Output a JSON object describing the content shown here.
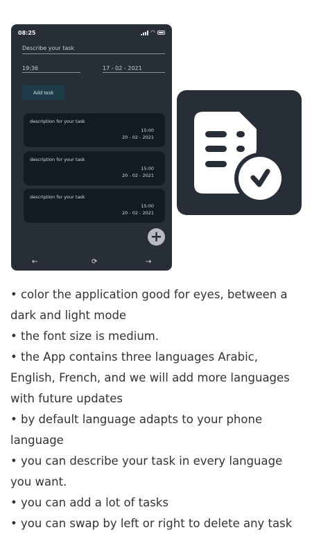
{
  "phone": {
    "status_time": "08:25",
    "task_placeholder": "Describe your task",
    "time_value": "19:36",
    "date_value": "17 - 02 - 2021",
    "add_task_label": "Add task",
    "tasks": [
      {
        "description": "description for your task",
        "time": "15:00",
        "date": "20 - 02 - 2021"
      },
      {
        "description": "description for your task",
        "time": "15:00",
        "date": "20 - 02 - 2021"
      },
      {
        "description": "description for your task",
        "time": "15:00",
        "date": "20 - 02 - 2021"
      }
    ],
    "nav": {
      "back": "←",
      "home": "⟳",
      "forward": "→"
    },
    "fab_symbol": "+"
  },
  "app_icon": {
    "name": "task-checklist-icon",
    "bg": "#272e38",
    "fg": "#ffffff"
  },
  "features": [
    "• color the application good for eyes, between a dark and light mode",
    "• the font size is medium.",
    "• the App contains three languages Arabic, English, French, and we will add more languages with future updates",
    "• by default language adapts to your phone language",
    "• you can describe your task in every language you want.",
    "• you can add a lot of tasks",
    "• you can swap by left or right to delete any task"
  ],
  "colors": {
    "phone_bg": "#272e38",
    "card_bg": "#121b21",
    "button_bg": "#1f3c4b"
  }
}
